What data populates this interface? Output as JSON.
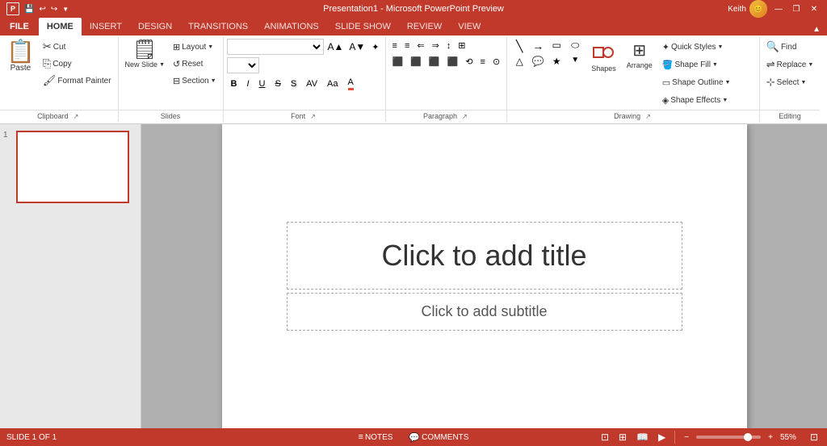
{
  "titleBar": {
    "title": "Presentation1 - Microsoft PowerPoint Preview",
    "quickAccess": [
      "💾",
      "↩",
      "↪"
    ],
    "userLabel": "Keith",
    "winBtns": [
      "—",
      "❐",
      "✕"
    ]
  },
  "ribbon": {
    "tabs": [
      "FILE",
      "HOME",
      "INSERT",
      "DESIGN",
      "TRANSITIONS",
      "ANIMATIONS",
      "SLIDE SHOW",
      "REVIEW",
      "VIEW"
    ],
    "activeTab": "HOME",
    "groups": {
      "clipboard": {
        "label": "Clipboard",
        "paste": "Paste",
        "cut": "Cut",
        "copy": "Copy",
        "formatPainter": "Format Painter"
      },
      "slides": {
        "label": "Slides",
        "newSlide": "New Slide",
        "layout": "Layout",
        "reset": "Reset",
        "section": "Section"
      },
      "font": {
        "label": "Font",
        "fontName": "",
        "fontSize": "",
        "bold": "B",
        "italic": "I",
        "underline": "U",
        "strikethrough": "S",
        "textShadow": "S",
        "characterSpacing": "AV",
        "changCase": "Aa",
        "fontColor": "A",
        "increaseFont": "A",
        "decreaseFont": "A",
        "clearFormatting": "✦"
      },
      "paragraph": {
        "label": "Paragraph",
        "bullets": "≡",
        "numbering": "≡",
        "decreaseIndent": "⇐",
        "increaseIndent": "⇒",
        "alignLeft": "≡",
        "alignCenter": "≡",
        "alignRight": "≡",
        "justify": "≡",
        "columns": "⊞",
        "lineSpacing": "≡",
        "textDirection": "⟲",
        "alignText": "≡",
        "convertToSmartArt": "⊙"
      },
      "drawing": {
        "label": "Drawing",
        "shapeFill": "Shape Fill",
        "shapeOutline": "Shape Outline",
        "shapeEffects": "Shape Effects",
        "quickStyles": "Quick Styles",
        "arrange": "Arrange"
      },
      "editing": {
        "label": "Editing",
        "find": "Find",
        "replace": "Replace",
        "select": "Select"
      }
    }
  },
  "slidePanel": {
    "slideNumber": "1",
    "slideCount": "1"
  },
  "slide": {
    "titlePlaceholder": "Click to add title",
    "subtitlePlaceholder": "Click to add subtitle"
  },
  "statusBar": {
    "slideInfo": "SLIDE 1 OF 1",
    "notes": "NOTES",
    "comments": "COMMENTS",
    "zoomLevel": "55%",
    "viewBtns": [
      "⊞",
      "⊟",
      "⊠",
      "⊡"
    ]
  }
}
